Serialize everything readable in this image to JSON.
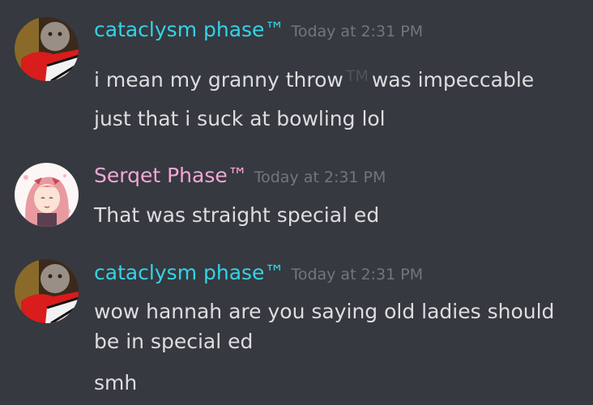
{
  "colors": {
    "background": "#36393f",
    "username_cyan": "#33d3e6",
    "username_pink": "#f4a6d7",
    "message_text": "#dcddde",
    "timestamp": "#72767d"
  },
  "messages": [
    {
      "username": "cataclysm phase™",
      "timestamp": "Today at 2:31 PM",
      "avatar_icon": "baby-photo-avatar",
      "lines": {
        "l1_before": "i mean my granny throw",
        "l1_tm": "TM",
        "l1_after": "was impeccable",
        "l2": "just that i suck at bowling lol"
      }
    },
    {
      "username": "Serqet Phase™",
      "timestamp": "Today at 2:31 PM",
      "avatar_icon": "anime-girl-avatar",
      "lines": {
        "l1": "That was straight special ed"
      }
    },
    {
      "username": "cataclysm phase™",
      "timestamp": "Today at 2:31 PM",
      "avatar_icon": "baby-photo-avatar",
      "lines": {
        "l1": "wow hannah are you saying old ladies should be in special ed",
        "l2": "smh"
      }
    }
  ]
}
